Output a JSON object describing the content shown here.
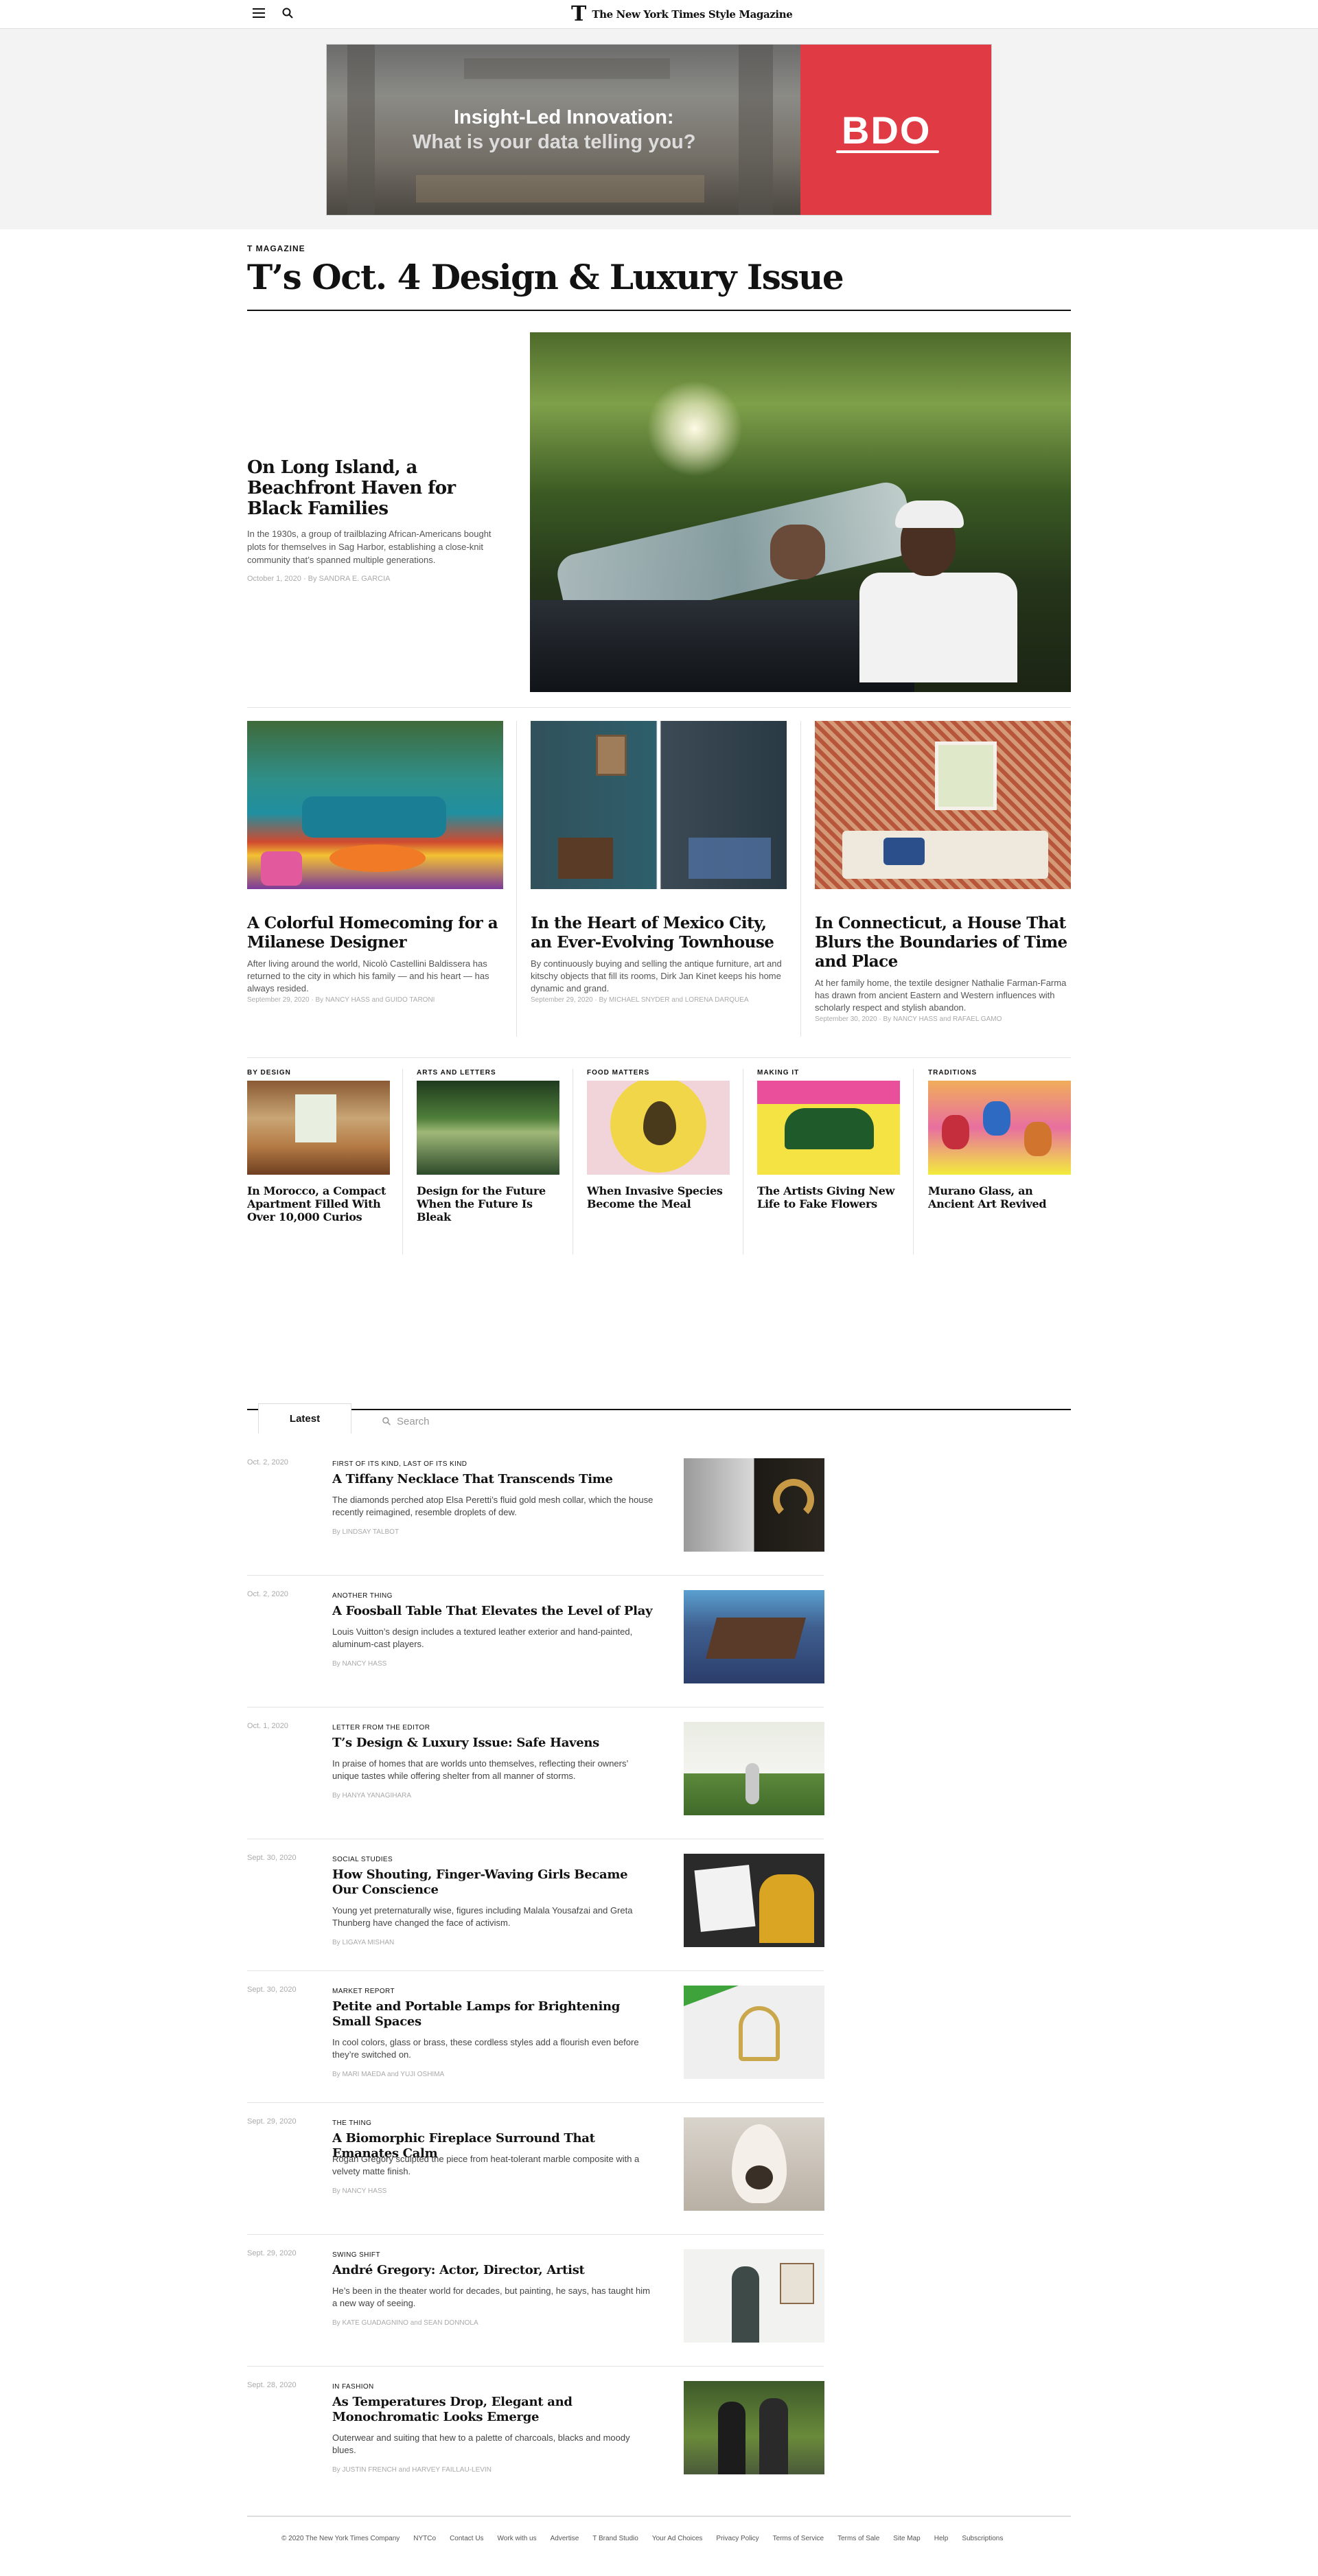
{
  "header": {
    "brand_mark": "T",
    "brand_name": "The New York Times Style Magazine"
  },
  "ad": {
    "headline": "Insight-Led Innovation:",
    "subline": "What is your data telling you?",
    "logo": "BDO"
  },
  "section": {
    "kicker": "T MAGAZINE",
    "title": "T’s Oct. 4 Design & Luxury Issue"
  },
  "hero": {
    "title": "On Long Island, a Beachfront Haven for Black Families",
    "summary": "In the 1930s, a group of trailblazing African-Americans bought plots for themselves in Sag Harbor, establishing a close-knit community that’s spanned multiple generations.",
    "meta": "October 1, 2020 · By SANDRA E. GARCIA"
  },
  "features": [
    {
      "title": "A Colorful Homecoming for a Milanese Designer",
      "summary": "After living around the world, Nicolò Castellini Baldissera has returned to the city in which his family — and his heart — has always resided.",
      "meta": "September 29, 2020 · By NANCY HASS and GUIDO TARONI"
    },
    {
      "title": "In the Heart of Mexico City, an Ever-Evolving Townhouse",
      "summary": "By continuously buying and selling the antique furniture, art and kitschy objects that fill its rooms, Dirk Jan Kinet keeps his home dynamic and grand.",
      "meta": "September 29, 2020 · By MICHAEL SNYDER and LORENA DARQUEA"
    },
    {
      "title": "In Connecticut, a House That Blurs the Boundaries of Time and Place",
      "summary": "At her family home, the textile designer Nathalie Farman-Farma has drawn from ancient Eastern and Western influences with scholarly respect and stylish abandon.",
      "meta": "September 30, 2020 · By NANCY HASS and RAFAEL GAMO"
    }
  ],
  "rubrics": [
    {
      "label": "BY DESIGN",
      "title": "In Morocco, a Compact Apartment Filled With Over 10,000 Curios"
    },
    {
      "label": "ARTS AND LETTERS",
      "title": "Design for the Future When the Future Is Bleak"
    },
    {
      "label": "FOOD MATTERS",
      "title": "When Invasive Species Become the Meal"
    },
    {
      "label": "MAKING IT",
      "title": "The Artists Giving New Life to Fake Flowers"
    },
    {
      "label": "TRADITIONS",
      "title": "Murano Glass, an Ancient Art Revived"
    }
  ],
  "latest": {
    "tab_label": "Latest",
    "search_placeholder": "Search",
    "items": [
      {
        "date": "Oct. 2, 2020",
        "kicker": "First of Its Kind, Last of Its Kind",
        "title": "A Tiffany Necklace That Transcends Time",
        "summary": "The diamonds perched atop Elsa Peretti’s fluid gold mesh collar, which the house recently reimagined, resemble droplets of dew.",
        "byline": "By LINDSAY TALBOT"
      },
      {
        "date": "Oct. 2, 2020",
        "kicker": "Another Thing",
        "title": "A Foosball Table That Elevates the Level of Play",
        "summary": "Louis Vuitton’s design includes a textured leather exterior and hand-painted, aluminum-cast players.",
        "byline": "By NANCY HASS"
      },
      {
        "date": "Oct. 1, 2020",
        "kicker": "Letter From the Editor",
        "title": "T’s Design & Luxury Issue: Safe Havens",
        "summary": "In praise of homes that are worlds unto themselves, reflecting their owners’ unique tastes while offering shelter from all manner of storms.",
        "byline": "By HANYA YANAGIHARA"
      },
      {
        "date": "Sept. 30, 2020",
        "kicker": "Social Studies",
        "title": "How Shouting, Finger-Waving Girls Became Our Conscience",
        "summary": "Young yet preternaturally wise, figures including Malala Yousafzai and Greta Thunberg have changed the face of activism.",
        "byline": "By LIGAYA MISHAN"
      },
      {
        "date": "Sept. 30, 2020",
        "kicker": "Market Report",
        "title": "Petite and Portable Lamps for Brightening Small Spaces",
        "summary": "In cool colors, glass or brass, these cordless styles add a flourish even before they’re switched on.",
        "byline": "By MARI MAEDA and YUJI OSHIMA"
      },
      {
        "date": "Sept. 29, 2020",
        "kicker": "The Thing",
        "title": "A Biomorphic Fireplace Surround That Emanates Calm",
        "summary": "Rogan Gregory sculpted the piece from heat-tolerant marble composite with a velvety matte finish.",
        "byline": "By NANCY HASS"
      },
      {
        "date": "Sept. 29, 2020",
        "kicker": "Swing Shift",
        "title": "André Gregory: Actor, Director, Artist",
        "summary": "He’s been in the theater world for decades, but painting, he says, has taught him a new way of seeing.",
        "byline": "By KATE GUADAGNINO and SEAN DONNOLA"
      },
      {
        "date": "Sept. 28, 2020",
        "kicker": "In Fashion",
        "title": "As Temperatures Drop, Elegant and Monochromatic Looks Emerge",
        "summary": "Outerwear and suiting that hew to a palette of charcoals, blacks and moody blues.",
        "byline": "By JUSTIN FRENCH and HARVEY FAILLAU-LEVIN"
      }
    ]
  },
  "footer": {
    "links": [
      "© 2020 The New York Times Company",
      "NYTCo",
      "Contact Us",
      "Work with us",
      "Advertise",
      "T Brand Studio",
      "Your Ad Choices",
      "Privacy Policy",
      "Terms of Service",
      "Terms of Sale",
      "Site Map",
      "Help",
      "Subscriptions"
    ]
  },
  "colors": {
    "accent_red": "#e03a45",
    "text": "#121212",
    "muted": "#aaaaaa"
  }
}
